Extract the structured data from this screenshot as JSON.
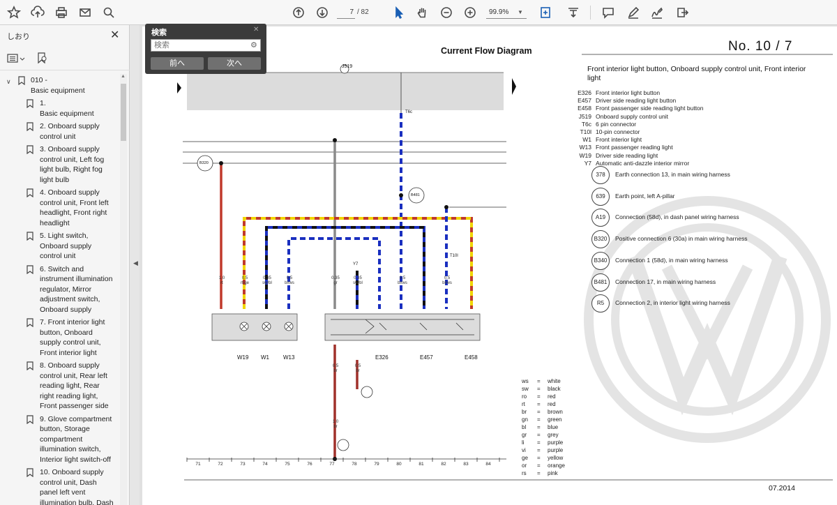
{
  "toolbar": {
    "icons": [
      "bookmark-star-icon",
      "upload-icon",
      "print-icon",
      "mail-icon",
      "find-icon",
      "page-up-icon",
      "page-down-icon",
      "select-cursor-icon",
      "hand-icon",
      "zoom-out-icon",
      "zoom-in-icon",
      "fit-page-icon",
      "scroll-mode-icon",
      "comment-icon",
      "pen-icon",
      "sign-icon",
      "share-icon"
    ],
    "page_current": "7",
    "page_total": "/ 82",
    "zoom": "99.9%",
    "accent_color": "#1a5fb4"
  },
  "sidebar": {
    "title": "しおり",
    "close": "✕",
    "bookmarks": [
      {
        "label": "010 -\nBasic equipment",
        "level": 0
      },
      {
        "label": "1.\nBasic equipment",
        "level": 1
      },
      {
        "label": "2. Onboard supply\ncontrol unit",
        "level": 1
      },
      {
        "label": "3. Onboard supply\ncontrol unit, Left fog\nlight bulb, Right fog\nlight bulb",
        "level": 1
      },
      {
        "label": "4. Onboard supply\ncontrol unit, Front left\nheadlight, Front right\nheadlight",
        "level": 1
      },
      {
        "label": "5. Light switch,\nOnboard supply\ncontrol unit",
        "level": 1
      },
      {
        "label": "6. Switch and\ninstrument illumination\nregulator, Mirror\nadjustment switch,\nOnboard supply",
        "level": 1
      },
      {
        "label": "7. Front interior light\nbutton, Onboard\nsupply control unit,\nFront interior light",
        "level": 1
      },
      {
        "label": "8. Onboard supply\ncontrol unit, Rear left\nreading light, Rear\nright reading light,\nFront passenger side",
        "level": 1
      },
      {
        "label": "9. Glove compartment\nbutton, Storage\ncompartment\nillumination switch,\nInterior light switch-off",
        "level": 1
      },
      {
        "label": "10. Onboard supply\ncontrol unit, Dash\npanel left vent\nillumination bulb, Dash",
        "level": 1
      }
    ]
  },
  "search": {
    "title": "検索",
    "placeholder": "検索",
    "prev": "前へ",
    "next": "次へ"
  },
  "document": {
    "header_title": "Current Flow Diagram",
    "doc_number": "No.  10 /  7",
    "legend_title": "Front interior light button, Onboard supply control unit, Front interior light",
    "legend": [
      {
        "code": "E326",
        "desc": "Front interior light button"
      },
      {
        "code": "E457",
        "desc": "Driver side reading light button"
      },
      {
        "code": "E458",
        "desc": "Front passenger side reading light button"
      },
      {
        "code": "J519",
        "desc": "Onboard supply control unit"
      },
      {
        "code": "T6c",
        "desc": "6 pin connector"
      },
      {
        "code": "T10l",
        "desc": "10-pin connector"
      },
      {
        "code": "W1",
        "desc": "Front interior light"
      },
      {
        "code": "W13",
        "desc": "Front passenger reading light"
      },
      {
        "code": "W19",
        "desc": "Driver side reading light"
      },
      {
        "code": "Y7",
        "desc": "Automatic anti-dazzle interior mirror"
      }
    ],
    "connections": [
      {
        "code": "378",
        "desc": "Earth connection 13, in main wiring harness"
      },
      {
        "code": "639",
        "desc": "Earth point, left A-pillar"
      },
      {
        "code": "A19",
        "desc": "Connection (58d), in dash panel wiring harness"
      },
      {
        "code": "B320",
        "desc": "Positive connection 6 (30a) in main wiring harness"
      },
      {
        "code": "B340",
        "desc": "Connection 1 (58d), in main wiring harness"
      },
      {
        "code": "B481",
        "desc": "Connection 17, in main wiring harness"
      },
      {
        "code": "R5",
        "desc": "Connection 2, in interior light wiring harness"
      }
    ],
    "color_codes": [
      {
        "abbr": "ws",
        "name": "white"
      },
      {
        "abbr": "sw",
        "name": "black"
      },
      {
        "abbr": "ro",
        "name": "red"
      },
      {
        "abbr": "rt",
        "name": "red"
      },
      {
        "abbr": "br",
        "name": "brown"
      },
      {
        "abbr": "gn",
        "name": "green"
      },
      {
        "abbr": "bl",
        "name": "blue"
      },
      {
        "abbr": "gr",
        "name": "grey"
      },
      {
        "abbr": "li",
        "name": "purple"
      },
      {
        "abbr": "vi",
        "name": "purple"
      },
      {
        "abbr": "ge",
        "name": "yellow"
      },
      {
        "abbr": "or",
        "name": "orange"
      },
      {
        "abbr": "rs",
        "name": "pink"
      }
    ],
    "color_eq": "=",
    "component_labels": {
      "w19": "W19",
      "w1": "W1",
      "w13": "W13",
      "e326": "E326",
      "e457": "E457",
      "e458": "E458",
      "j519": "J519",
      "y7": "Y7",
      "b320": "B320",
      "b481": "B481",
      "t6c": "T6c",
      "t10l": "T10l"
    },
    "wires": [
      {
        "size": "1.0",
        "color": "rt"
      },
      {
        "size": "0.5",
        "color": "rt/ge"
      },
      {
        "size": "0.35",
        "color": "sw/bl"
      },
      {
        "size": "0.5",
        "color": "bl/ws"
      },
      {
        "size": "0.35",
        "color": "gr"
      },
      {
        "size": "0.35",
        "color": "sw/bl"
      },
      {
        "size": "0.5",
        "color": "bl/ws"
      },
      {
        "size": "0.5",
        "color": "bl/ws"
      },
      {
        "size": "0.5",
        "color": "br"
      },
      {
        "size": "0.5",
        "color": "br"
      },
      {
        "size": "1.0",
        "color": "br"
      }
    ],
    "track_numbers": [
      "71",
      "72",
      "73",
      "74",
      "75",
      "76",
      "77",
      "78",
      "79",
      "80",
      "81",
      "82",
      "83",
      "84"
    ],
    "date": "07.2014",
    "wire_colors": {
      "red": "#c0392b",
      "yellow": "#f1d600",
      "blue": "#1a2fbf",
      "black": "#111111",
      "grey": "#8a8a8a",
      "brown": "#a0302a"
    }
  }
}
